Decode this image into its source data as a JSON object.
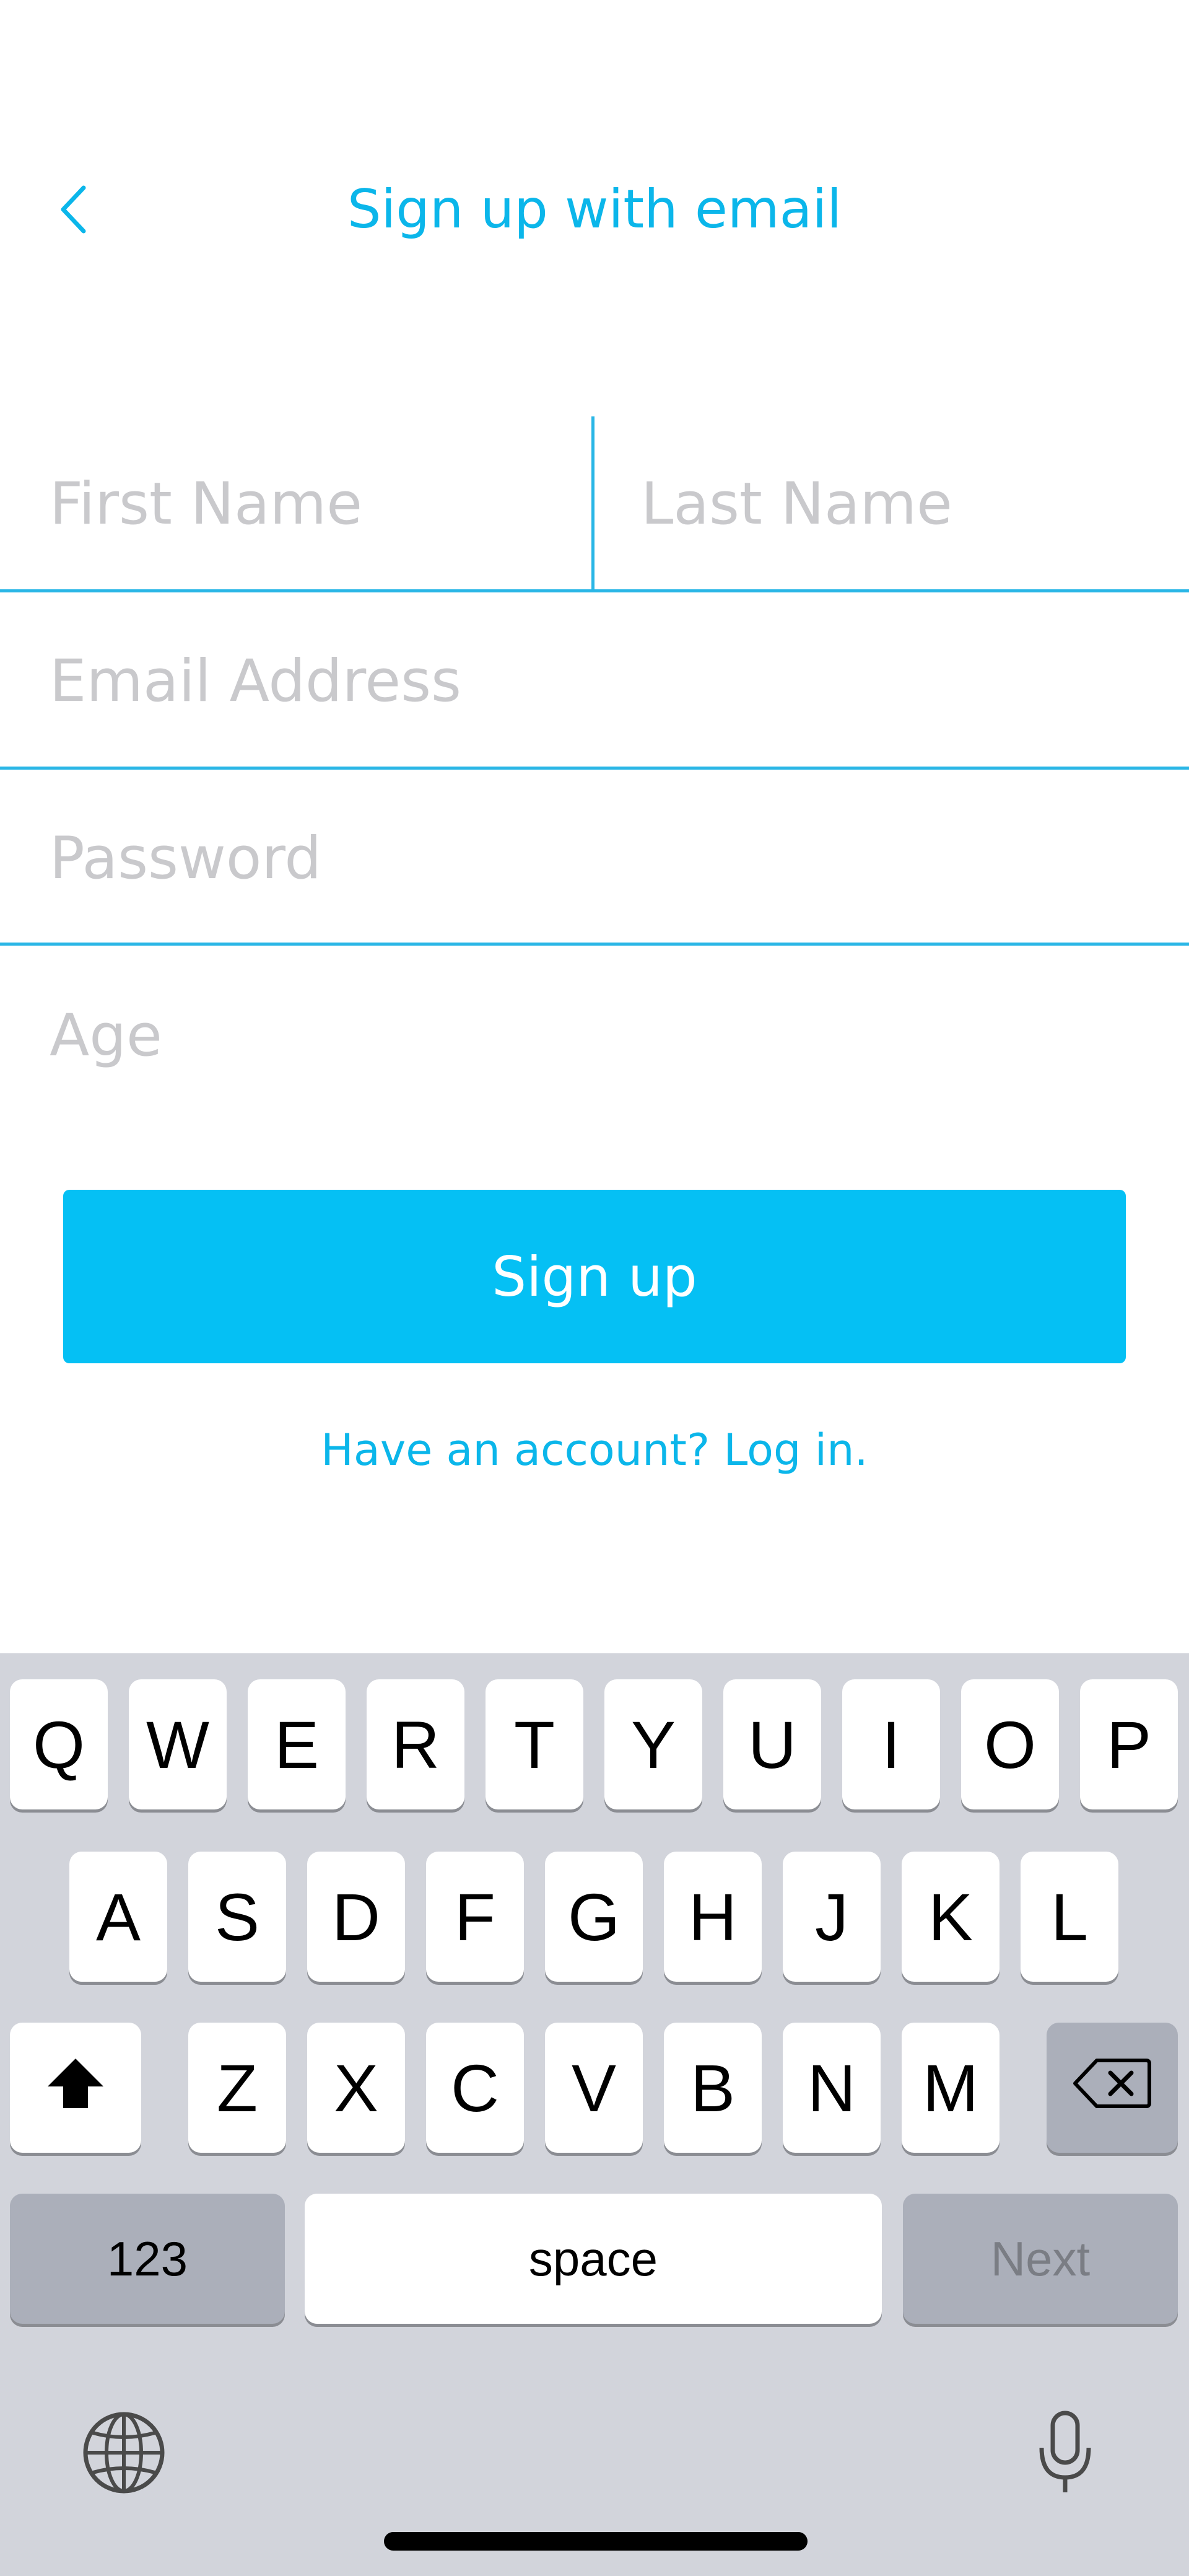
{
  "header": {
    "title": "Sign up with email",
    "back_icon": "chevron-left-icon"
  },
  "form": {
    "first_name_placeholder": "First Name",
    "last_name_placeholder": "Last Name",
    "email_placeholder": "Email Address",
    "password_placeholder": "Password",
    "age_placeholder": "Age"
  },
  "actions": {
    "signup_label": "Sign up",
    "login_link": "Have an account? Log in."
  },
  "keyboard": {
    "row1": [
      "Q",
      "W",
      "E",
      "R",
      "T",
      "Y",
      "U",
      "I",
      "O",
      "P"
    ],
    "row2": [
      "A",
      "S",
      "D",
      "F",
      "G",
      "H",
      "J",
      "K",
      "L"
    ],
    "row3": [
      "Z",
      "X",
      "C",
      "V",
      "B",
      "N",
      "M"
    ],
    "shift_icon": "shift-icon",
    "backspace_icon": "backspace-icon",
    "numbers_label": "123",
    "space_label": "space",
    "return_label": "Next",
    "globe_icon": "globe-icon",
    "mic_icon": "microphone-icon"
  },
  "colors": {
    "accent": "#05c0f4",
    "accent_text": "#0bb6ea",
    "divider": "#29b6e6",
    "placeholder": "#c9c9cc",
    "keyboard_bg": "#d2d4db",
    "key_dark": "#abafba"
  }
}
